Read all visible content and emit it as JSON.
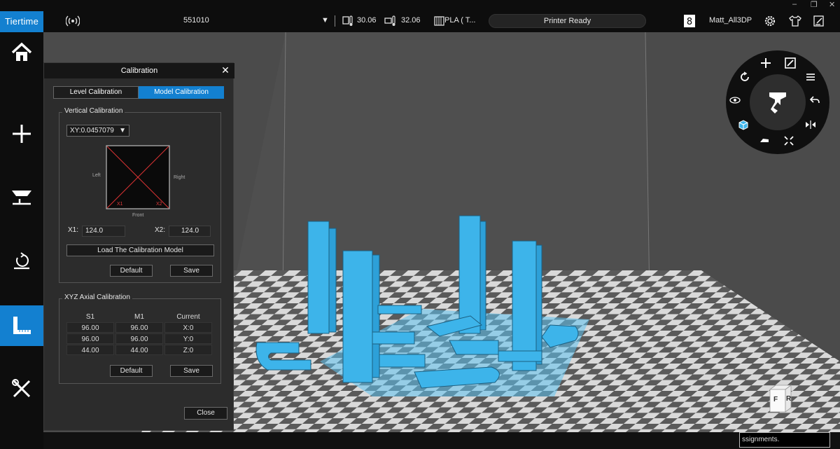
{
  "app": {
    "brand": "Tiertime",
    "window_controls": [
      "–",
      "❐",
      "✕"
    ]
  },
  "topbar": {
    "printer_name": "551010",
    "nozzle_temp": "30.06",
    "bed_temp": "32.06",
    "material": "PLA ( T...",
    "status": "Printer Ready",
    "user_name": "Matt_All3DP"
  },
  "sidebar": {
    "items": [
      {
        "name": "home",
        "icon": "home-icon"
      },
      {
        "name": "add",
        "icon": "plus-icon"
      },
      {
        "name": "print",
        "icon": "print-icon"
      },
      {
        "name": "reset",
        "icon": "reset-icon"
      },
      {
        "name": "calibration",
        "icon": "ruler-icon",
        "active": true
      },
      {
        "name": "tools",
        "icon": "tools-icon"
      }
    ],
    "accent": "#1380d0"
  },
  "dialog": {
    "title": "Calibration",
    "tabs": [
      {
        "label": "Level Calibration",
        "active": false
      },
      {
        "label": "Model Calibration",
        "active": true
      }
    ],
    "vertical": {
      "label": "Vertical Calibration",
      "select_value": "XY:0.0457079",
      "diagram": {
        "left": "Left",
        "right": "Right",
        "front": "Front",
        "x1_tag": "X1",
        "x2_tag": "X2"
      },
      "x1_label": "X1:",
      "x1_value": "124.0",
      "x2_label": "X2:",
      "x2_value": "124.0",
      "load_button": "Load The Calibration Model",
      "default_button": "Default",
      "save_button": "Save"
    },
    "xyz": {
      "label": "XYZ Axial Calibration",
      "headers": [
        "S1",
        "M1",
        "Current"
      ],
      "rows": [
        [
          "96.00",
          "96.00",
          "X:0"
        ],
        [
          "96.00",
          "96.00",
          "Y:0"
        ],
        [
          "44.00",
          "44.00",
          "Z:0"
        ]
      ],
      "default_button": "Default",
      "save_button": "Save"
    },
    "close_button": "Close"
  },
  "viewport": {
    "model_color": "#3db4ea",
    "bed_light": "#d9d9d9",
    "bed_dark": "#5a5a5a",
    "background": "#4b4b4b"
  },
  "viewcube": {
    "front": "F",
    "right": "R"
  },
  "bottom": {
    "assignments_text": "ssignments."
  }
}
